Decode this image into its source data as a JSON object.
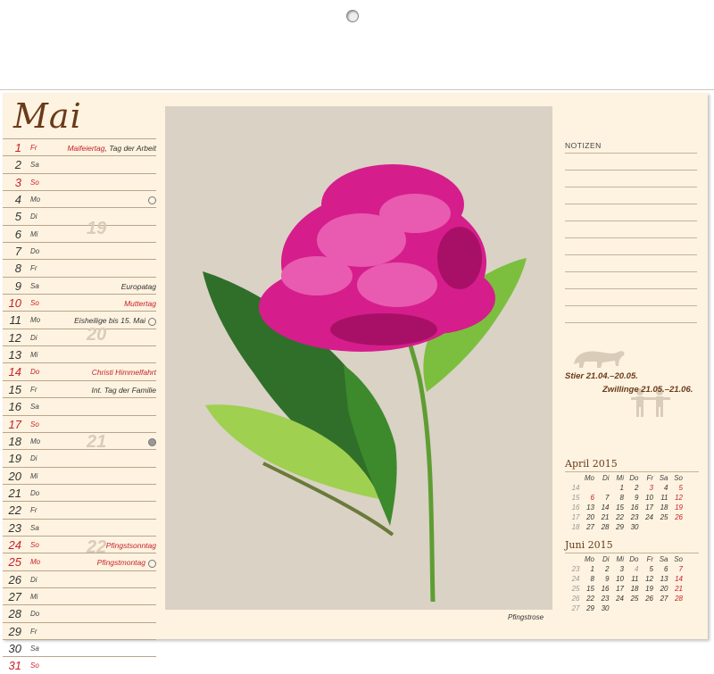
{
  "month": "Mai",
  "days": [
    {
      "n": "1",
      "wd": "Fr",
      "ev": "Maifeiertag",
      "ev2": ", Tag der Arbeit",
      "red": true,
      "moon": ""
    },
    {
      "n": "2",
      "wd": "Sa",
      "ev": "",
      "red": false,
      "moon": ""
    },
    {
      "n": "3",
      "wd": "So",
      "ev": "",
      "red": true,
      "moon": ""
    },
    {
      "n": "4",
      "wd": "Mo",
      "ev": "",
      "red": false,
      "moon": "full"
    },
    {
      "n": "5",
      "wd": "Di",
      "ev": "",
      "red": false,
      "moon": ""
    },
    {
      "n": "6",
      "wd": "Mi",
      "ev": "",
      "red": false,
      "moon": ""
    },
    {
      "n": "7",
      "wd": "Do",
      "ev": "",
      "red": false,
      "moon": ""
    },
    {
      "n": "8",
      "wd": "Fr",
      "ev": "",
      "red": false,
      "moon": ""
    },
    {
      "n": "9",
      "wd": "Sa",
      "ev": "Europatag",
      "red": false,
      "moon": ""
    },
    {
      "n": "10",
      "wd": "So",
      "ev": "Muttertag",
      "red": true,
      "moon": ""
    },
    {
      "n": "11",
      "wd": "Mo",
      "ev": "Eisheilige bis 15. Mai",
      "red": false,
      "moon": "half"
    },
    {
      "n": "12",
      "wd": "Di",
      "ev": "",
      "red": false,
      "moon": ""
    },
    {
      "n": "13",
      "wd": "Mi",
      "ev": "",
      "red": false,
      "moon": ""
    },
    {
      "n": "14",
      "wd": "Do",
      "ev": "Christi Himmelfahrt",
      "red": true,
      "moon": ""
    },
    {
      "n": "15",
      "wd": "Fr",
      "ev": "Int. Tag der Familie",
      "red": false,
      "moon": ""
    },
    {
      "n": "16",
      "wd": "Sa",
      "ev": "",
      "red": false,
      "moon": ""
    },
    {
      "n": "17",
      "wd": "So",
      "ev": "",
      "red": true,
      "moon": ""
    },
    {
      "n": "18",
      "wd": "Mo",
      "ev": "",
      "red": false,
      "moon": "new"
    },
    {
      "n": "19",
      "wd": "Di",
      "ev": "",
      "red": false,
      "moon": ""
    },
    {
      "n": "20",
      "wd": "Mi",
      "ev": "",
      "red": false,
      "moon": ""
    },
    {
      "n": "21",
      "wd": "Do",
      "ev": "",
      "red": false,
      "moon": ""
    },
    {
      "n": "22",
      "wd": "Fr",
      "ev": "",
      "red": false,
      "moon": ""
    },
    {
      "n": "23",
      "wd": "Sa",
      "ev": "",
      "red": false,
      "moon": ""
    },
    {
      "n": "24",
      "wd": "So",
      "ev": "Pfingstsonntag",
      "red": true,
      "moon": ""
    },
    {
      "n": "25",
      "wd": "Mo",
      "ev": "Pfingstmontag",
      "red": true,
      "moon": "half"
    },
    {
      "n": "26",
      "wd": "Di",
      "ev": "",
      "red": false,
      "moon": ""
    },
    {
      "n": "27",
      "wd": "Mi",
      "ev": "",
      "red": false,
      "moon": ""
    },
    {
      "n": "28",
      "wd": "Do",
      "ev": "",
      "red": false,
      "moon": ""
    },
    {
      "n": "29",
      "wd": "Fr",
      "ev": "",
      "red": false,
      "moon": ""
    },
    {
      "n": "30",
      "wd": "Sa",
      "ev": "",
      "red": false,
      "moon": ""
    },
    {
      "n": "31",
      "wd": "So",
      "ev": "",
      "red": true,
      "moon": ""
    }
  ],
  "weeks": [
    "19",
    "20",
    "21",
    "22"
  ],
  "caption": "Pfingstrose",
  "notes_label": "NOTIZEN",
  "zodiac": {
    "a": "Stier 21.04.–20.05.",
    "b": "Zwillinge 21.05.–21.06."
  },
  "mini": [
    {
      "title": "April 2015",
      "head": [
        "",
        "Mo",
        "Di",
        "Mi",
        "Do",
        "Fr",
        "Sa",
        "So"
      ],
      "rows": [
        [
          "14",
          "",
          "",
          "1",
          "2",
          "3",
          "4",
          "5"
        ],
        [
          "15",
          "6",
          "7",
          "8",
          "9",
          "10",
          "11",
          "12"
        ],
        [
          "16",
          "13",
          "14",
          "15",
          "16",
          "17",
          "18",
          "19"
        ],
        [
          "17",
          "20",
          "21",
          "22",
          "23",
          "24",
          "25",
          "26"
        ],
        [
          "18",
          "27",
          "28",
          "29",
          "30",
          "",
          "",
          ""
        ]
      ],
      "red": [
        [
          0,
          5
        ],
        [
          0,
          7
        ],
        [
          1,
          1
        ],
        [
          1,
          7
        ],
        [
          2,
          7
        ],
        [
          3,
          7
        ]
      ]
    },
    {
      "title": "Juni 2015",
      "head": [
        "",
        "Mo",
        "Di",
        "Mi",
        "Do",
        "Fr",
        "Sa",
        "So"
      ],
      "rows": [
        [
          "23",
          "1",
          "2",
          "3",
          "4",
          "5",
          "6",
          "7"
        ],
        [
          "24",
          "8",
          "9",
          "10",
          "11",
          "12",
          "13",
          "14"
        ],
        [
          "25",
          "15",
          "16",
          "17",
          "18",
          "19",
          "20",
          "21"
        ],
        [
          "26",
          "22",
          "23",
          "24",
          "25",
          "26",
          "27",
          "28"
        ],
        [
          "27",
          "29",
          "30",
          "",
          "",
          "",
          "",
          ""
        ]
      ],
      "red": [
        [
          0,
          7
        ],
        [
          1,
          7
        ],
        [
          2,
          7
        ],
        [
          3,
          7
        ]
      ],
      "grey": [
        [
          0,
          4
        ]
      ]
    }
  ],
  "colors": {
    "red": "#c8202c",
    "brown": "#6a3a1a",
    "paper": "#fdf3e0",
    "petal": "#d61d8c",
    "leaf": "#3f8a2a"
  }
}
